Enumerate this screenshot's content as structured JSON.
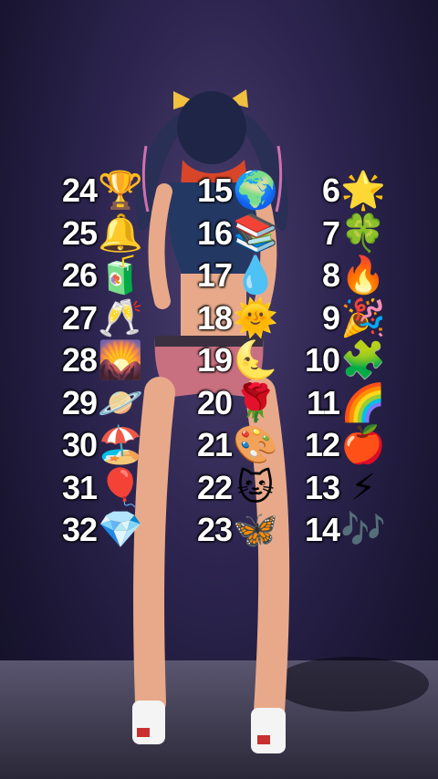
{
  "columns": [
    {
      "rows": [
        {
          "num": "24",
          "emoji": "🏆",
          "icon": "trophy-icon"
        },
        {
          "num": "25",
          "emoji": "🔔",
          "icon": "bell-icon"
        },
        {
          "num": "26",
          "emoji": "🧃",
          "icon": "juice-box-icon"
        },
        {
          "num": "27",
          "emoji": "🥂",
          "icon": "champagne-glasses-icon"
        },
        {
          "num": "28",
          "emoji": "🌄",
          "icon": "sunrise-mountains-icon"
        },
        {
          "num": "29",
          "emoji": "🪐",
          "icon": "ringed-planet-icon"
        },
        {
          "num": "30",
          "emoji": "🏖️",
          "icon": "beach-umbrella-icon"
        },
        {
          "num": "31",
          "emoji": "🎈",
          "icon": "balloon-icon"
        },
        {
          "num": "32",
          "emoji": "💎",
          "icon": "gem-icon"
        }
      ]
    },
    {
      "rows": [
        {
          "num": "15",
          "emoji": "🌍",
          "icon": "globe-icon"
        },
        {
          "num": "16",
          "emoji": "📚",
          "icon": "books-icon"
        },
        {
          "num": "17",
          "emoji": "💧",
          "icon": "droplet-icon"
        },
        {
          "num": "18",
          "emoji": "🌞",
          "icon": "sun-face-icon"
        },
        {
          "num": "19",
          "emoji": "🌜",
          "icon": "crescent-moon-icon"
        },
        {
          "num": "20",
          "emoji": "🌹",
          "icon": "rose-icon"
        },
        {
          "num": "21",
          "emoji": "🎨",
          "icon": "palette-icon"
        },
        {
          "num": "22",
          "emoji": "🐱",
          "icon": "cat-face-icon"
        },
        {
          "num": "23",
          "emoji": "🦋",
          "icon": "butterfly-icon"
        }
      ]
    },
    {
      "rows": [
        {
          "num": "6",
          "emoji": "🌟",
          "icon": "glowing-star-icon"
        },
        {
          "num": "7",
          "emoji": "🍀",
          "icon": "four-leaf-clover-icon"
        },
        {
          "num": "8",
          "emoji": "🔥",
          "icon": "fire-icon"
        },
        {
          "num": "9",
          "emoji": "🎉",
          "icon": "party-popper-icon"
        },
        {
          "num": "10",
          "emoji": "🧩",
          "icon": "puzzle-piece-icon"
        },
        {
          "num": "11",
          "emoji": "🌈",
          "icon": "rainbow-icon"
        },
        {
          "num": "12",
          "emoji": "🍎",
          "icon": "red-apple-icon"
        },
        {
          "num": "13",
          "emoji": "⚡",
          "icon": "lightning-icon"
        },
        {
          "num": "14",
          "emoji": "🎶",
          "icon": "musical-notes-icon"
        }
      ]
    }
  ]
}
